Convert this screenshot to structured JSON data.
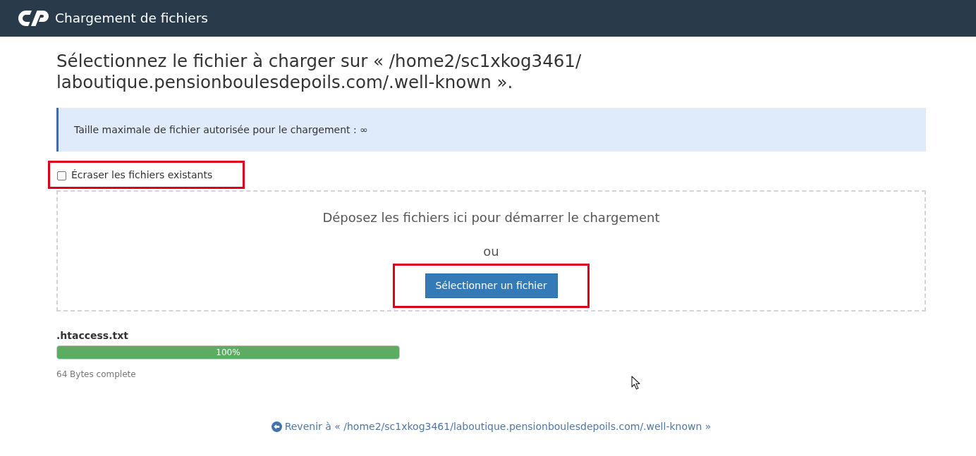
{
  "header": {
    "title": "Chargement de fichiers"
  },
  "heading": {
    "lines": [
      "Sélectionnez le fichier à charger sur « /home2/sc1xkog3461/",
      "laboutique.pensionboulesdepoils.com/.well-known »."
    ]
  },
  "info_alert": {
    "text": "Taille maximale de fichier autorisée pour le chargement : ∞"
  },
  "overwrite_option": {
    "label": "Écraser les fichiers existants",
    "checked": false,
    "highlighted": true
  },
  "dropzone": {
    "prompt": "Déposez les fichiers ici pour démarrer le chargement",
    "separator": "ou",
    "button": {
      "label": "Sélectionner un fichier",
      "highlighted": true
    }
  },
  "uploads": [
    {
      "filename": ".htaccess.txt",
      "level": 1,
      "progress_label": "100%",
      "status": "64 Bytes complete"
    }
  ],
  "back_link": {
    "text": "Revenir à « /home2/sc1xkog3461/laboutique.pensionboulesdepoils.com/.well-known »"
  }
}
